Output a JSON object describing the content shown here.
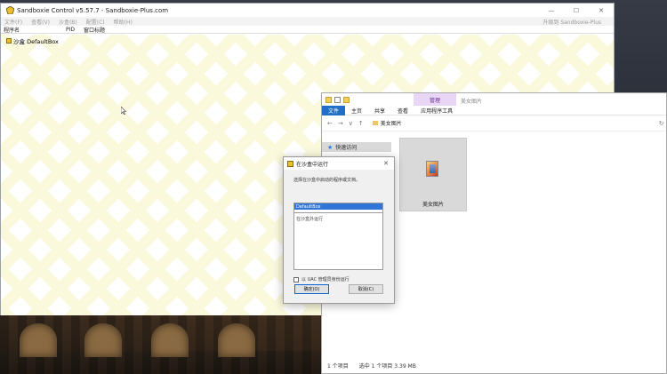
{
  "sandboxie": {
    "title": "Sandboxie Control v5.57.7 - Sandboxie-Plus.com",
    "menus": [
      "文件(F)",
      "查看(V)",
      "沙盒(B)",
      "配置(C)",
      "帮助(H)"
    ],
    "upgrade": "升级到 Sandboxie-Plus",
    "columns": [
      "程序名",
      "PID",
      "窗口标题"
    ],
    "tree_item": "沙盒 DefaultBox",
    "window_controls": [
      "—",
      "☐",
      "✕"
    ]
  },
  "explorer": {
    "manage_tab": "管理",
    "title": "美女图片",
    "ribbon": [
      "文件",
      "主页",
      "共享",
      "查看",
      "应用程序工具"
    ],
    "nav_arrows": [
      "←",
      "→",
      "∨",
      "↑"
    ],
    "path": "美女图片",
    "refresh": "↻",
    "nav_quick_access": "快速访问",
    "file_name": "美女图片",
    "status_count": "1 个项目",
    "status_selected": "选中 1 个项目  3.39 MB"
  },
  "dialog": {
    "title": "在沙盒中运行",
    "close": "✕",
    "prompt": "选择在沙盒中启动的程序或文档。",
    "sandbox_selected": "DefaultBox",
    "outside_option": "在沙盒外运行",
    "uac_label": "以 UAC 管理员身份运行",
    "ok_label": "确定(O)",
    "cancel_label": "取消(C)"
  }
}
